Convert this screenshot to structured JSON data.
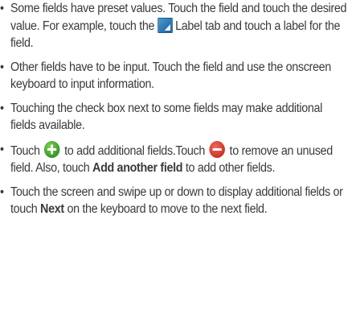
{
  "bullet_char": "•",
  "colors": {
    "text": "#3a3a3a",
    "plus_icon": "#3f9e2c",
    "minus_icon": "#d33a2c",
    "label_tab_icon": "#2e78b3"
  },
  "icons": {
    "label_tab": "label-tab-icon",
    "add": "plus-circle-icon",
    "remove": "minus-circle-icon"
  },
  "bullets": [
    {
      "text_a": "Some fields have preset values. Touch the field and touch the desired value. For example, touch the ",
      "text_b": "Label tab and touch a label for the field."
    },
    {
      "text": "Other fields have to be input. Touch the field and use the onscreen keyboard to input information."
    },
    {
      "text": "Touching the check box next to some fields may make additional fields available."
    },
    {
      "text_a": "Touch ",
      "text_b": " to add additional fields.Touch ",
      "text_c": " to remove an unused field. Also, touch ",
      "bold": "Add another field",
      "text_d": " to add other fields."
    },
    {
      "text_a": "Touch the screen and swipe up or down to display additional fields or touch ",
      "bold": "Next",
      "text_b": " on the keyboard to move to the next field."
    }
  ]
}
